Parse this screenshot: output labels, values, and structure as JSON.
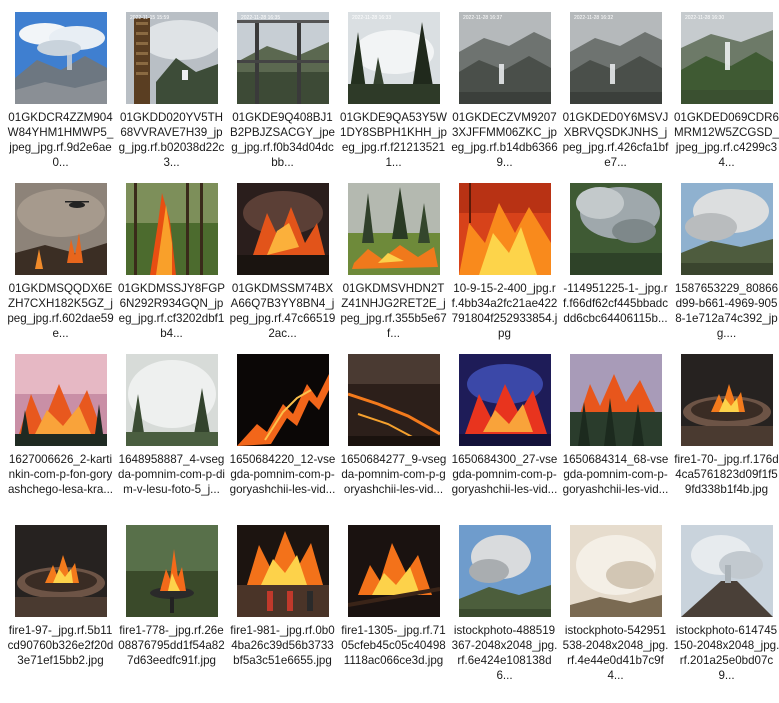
{
  "files": [
    {
      "name": "01GKDCR4ZZM904W84YHM1HMWP5_jpeg_jpg.rf.9d2e6ae0...",
      "scene": "mountain-smoke",
      "icon": "image-file-icon"
    },
    {
      "name": "01GKDD020YV5TH68VVRAVE7H39_jpg_jpg.rf.b02038d22c3...",
      "scene": "tower-smoke",
      "icon": "image-file-icon",
      "stamp": "2022-11-15 15:59"
    },
    {
      "name": "01GKDE9Q408BJ1B2PBJZSACGY_jpeg_jpg.rf.f0b34d04dcbb...",
      "scene": "balcony-forest",
      "icon": "image-file-icon",
      "stamp": "2022-11-28 16:35"
    },
    {
      "name": "01GKDE9QA53Y5W1DY8SBPH1KHH_jpeg_jpg.rf.f212135211...",
      "scene": "forest-fog",
      "icon": "image-file-icon",
      "stamp": "2022-11-28 16:33"
    },
    {
      "name": "01GKDECZVM92073XJFFMM06ZKC_jpeg_jpg.rf.b14db63669...",
      "scene": "gray-valley",
      "icon": "image-file-icon",
      "stamp": "2022-11-28 16:37"
    },
    {
      "name": "01GKDED0Y6MSVJXBRVQSDKJNHS_jpeg_jpg.rf.426cfa1bfe7...",
      "scene": "gray-valley",
      "icon": "image-file-icon",
      "stamp": "2022-11-28 16:32"
    },
    {
      "name": "01GKDED069CDR6MRM12W5ZCGSD_jpeg_jpg.rf.c4299c34...",
      "scene": "green-valley",
      "icon": "image-file-icon",
      "stamp": "2022-11-28 16:30"
    },
    {
      "name": "01GKDMSQQDX6EZH7CXH182K5GZ_jpeg_jpg.rf.602dae59e...",
      "scene": "heli-fire",
      "icon": "image-file-icon"
    },
    {
      "name": "01GKDMSSJY8FGP6N292R934GQN_jpeg_jpg.rf.cf3202dbf1b4...",
      "scene": "tree-flame",
      "icon": "image-file-icon"
    },
    {
      "name": "01GKDMSSM74BXA66Q7B3YY8BN4_jpeg_jpg.rf.47c665192ac...",
      "scene": "dark-fire",
      "icon": "image-file-icon"
    },
    {
      "name": "01GKDMSVHDN2TZ41NHJG2RET2E_jpeg_jpg.rf.355b5e67f...",
      "scene": "pine-ground-fire",
      "icon": "image-file-icon"
    },
    {
      "name": "10-9-15-2-400_jpg.rf.4bb34a2fc21ae422791804f252933854.jpg",
      "scene": "orange-blaze",
      "icon": "image-file-icon"
    },
    {
      "name": "-114951225-1-_jpg.rf.f66df62cf445bbadcdd6cbc64406115b...",
      "scene": "aerial-smoke",
      "icon": "image-file-icon"
    },
    {
      "name": "1587653229_80866d99-b661-4969-9058-1e712a74c392_jpg....",
      "scene": "plume-blue",
      "icon": "image-file-icon"
    },
    {
      "name": "1627006626_2-kartinkin-com-p-fon-goryashchego-lesa-kra...",
      "scene": "pink-forest-fire",
      "icon": "image-file-icon"
    },
    {
      "name": "1648958887_4-vsegda-pomnim-com-p-dim-v-lesu-foto-5_j...",
      "scene": "white-smoke",
      "icon": "image-file-icon"
    },
    {
      "name": "1650684220_12-vsegda-pomnim-com-p-goryashchii-les-vid...",
      "scene": "night-fireline",
      "icon": "image-file-icon"
    },
    {
      "name": "1650684277_9-vsegda-pomnim-com-p-goryashchii-les-vid...",
      "scene": "aerial-fireline",
      "icon": "image-file-icon"
    },
    {
      "name": "1650684300_27-vsegda-pomnim-com-p-goryashchii-les-vid...",
      "scene": "neon-fire",
      "icon": "image-file-icon"
    },
    {
      "name": "1650684314_68-vsegda-pomnim-com-p-goryashchii-les-vid...",
      "scene": "purple-forest",
      "icon": "image-file-icon"
    },
    {
      "name": "fire1-70-_jpg.rf.176d4ca5761823d09f1f59fd338b1f4b.jpg",
      "scene": "fire-pit",
      "icon": "image-file-icon"
    },
    {
      "name": "fire1-97-_jpg.rf.5b11cd90760b326e2f20d3e71ef15bb2.jpg",
      "scene": "fire-pit",
      "icon": "image-file-icon"
    },
    {
      "name": "fire1-778-_jpg.rf.26e08876795dd1f54a827d63eedfc91f.jpg",
      "scene": "fire-bowl",
      "icon": "image-file-icon"
    },
    {
      "name": "fire1-981-_jpg.rf.0b04ba26c39d56b3733bf5a3c51e6655.jpg",
      "scene": "house-fire",
      "icon": "image-file-icon"
    },
    {
      "name": "fire1-1305-_jpg.rf.7105cfeb45c05c404981118ac066ce3d.jpg",
      "scene": "branch-fire",
      "icon": "image-file-icon"
    },
    {
      "name": "istockphoto-488519367-2048x2048_jpg.rf.6e424e108138d6...",
      "scene": "sky-plume",
      "icon": "image-file-icon"
    },
    {
      "name": "istockphoto-542951538-2048x2048_jpg.rf.4e44e0d41b7c9f4...",
      "scene": "hazy-smoke",
      "icon": "image-file-icon"
    },
    {
      "name": "istockphoto-614745150-2048x2048_jpg.rf.201a25e0bd07c9...",
      "scene": "volcano-smoke",
      "icon": "image-file-icon"
    }
  ]
}
